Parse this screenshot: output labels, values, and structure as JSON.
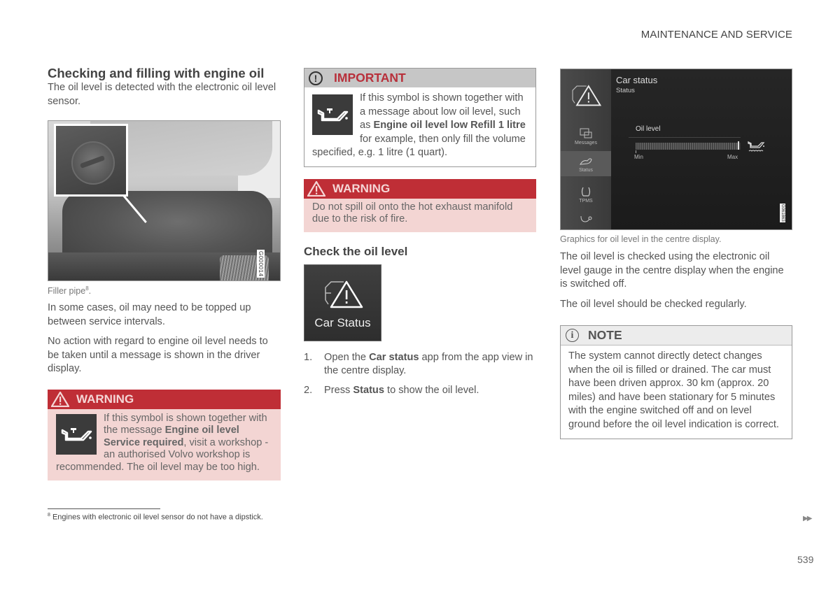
{
  "header": {
    "section_title": "MAINTENANCE AND SERVICE"
  },
  "column1": {
    "title": "Checking and filling with engine oil",
    "intro": "The oil level is detected with the electronic oil level sensor.",
    "photo": {
      "image_code": "G000014",
      "caption": "Filler pipe",
      "caption_footnote_ref": "8"
    },
    "para1": "In some cases, oil may need to be topped up between service intervals.",
    "para2": "No action with regard to engine oil level needs to be taken until a message is shown in the driver display.",
    "warning": {
      "label": "WARNING",
      "icon": "oil-can-icon",
      "text_before": "If this symbol is shown together with the message ",
      "bold": "Engine oil level Service required",
      "text_after": ", visit a workshop - an authorised Volvo workshop is recommended. The oil level may be too high."
    }
  },
  "column2": {
    "important": {
      "label": "IMPORTANT",
      "icon": "oil-can-icon",
      "text_before": "If this symbol is shown together with a message about low oil level, such as ",
      "bold": "Engine oil level low Refill 1 litre",
      "text_after": " for example, then only fill the volume specified, e.g. 1 litre (1 quart)."
    },
    "warning": {
      "label": "WARNING",
      "text": "Do not spill oil onto the hot exhaust manifold due to the risk of fire."
    },
    "subheading": "Check the oil level",
    "app_tile": {
      "label": "Car Status",
      "icon": "car-warning-icon"
    },
    "steps": [
      {
        "num": "1.",
        "before": "Open the ",
        "bold": "Car status",
        "after": " app from the app view in the centre display."
      },
      {
        "num": "2.",
        "before": "Press ",
        "bold": "Status",
        "after": " to show the oil level."
      }
    ]
  },
  "column3": {
    "screen": {
      "title": "Car status",
      "subtitle": "Status",
      "sidebar": [
        {
          "label": "",
          "icon": "car-warning-icon"
        },
        {
          "label": "Messages",
          "icon": "messages-icon"
        },
        {
          "label": "Status",
          "icon": "status-icon",
          "selected": true
        },
        {
          "label": "TPMS",
          "icon": "tpms-icon"
        },
        {
          "label": "",
          "icon": "service-icon"
        }
      ],
      "oil_level_label": "Oil level",
      "min_label": "Min",
      "max_label": "Max",
      "oil_level_fraction": 0.97,
      "image_code": "G061863"
    },
    "caption": "Graphics for oil level in the centre display.",
    "para1": "The oil level is checked using the electronic oil level gauge in the centre display when the engine is switched off.",
    "para2": "The oil level should be checked regularly.",
    "note": {
      "label": "NOTE",
      "text": "The system cannot directly detect changes when the oil is filled or drained. The car must have been driven approx. 30 km (approx. 20 miles) and have been stationary for 5 minutes with the engine switched off and on level ground before the oil level indication is correct."
    }
  },
  "footnote": {
    "ref": "8",
    "text": " Engines with electronic oil level sensor do not have a dipstick."
  },
  "footer": {
    "next_arrows": "▶▶",
    "page_number": "539"
  }
}
